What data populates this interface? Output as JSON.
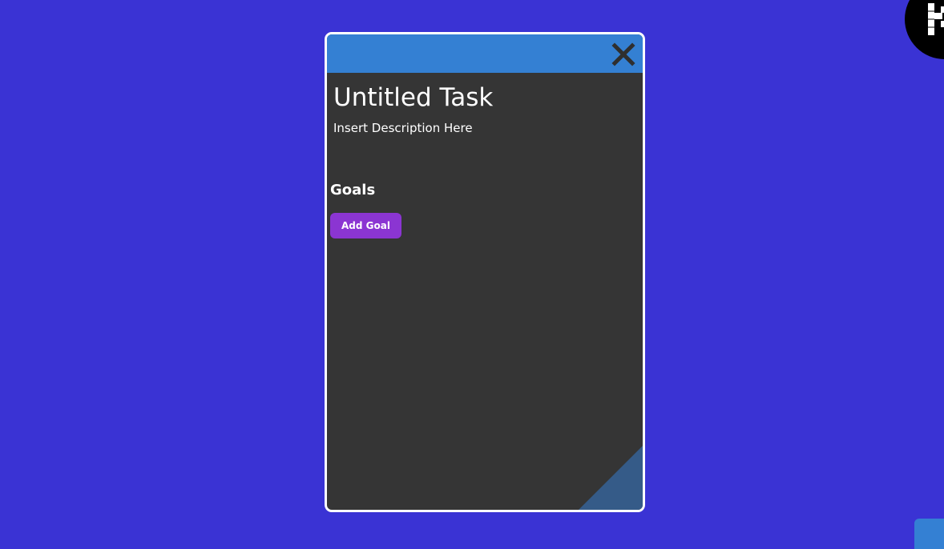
{
  "task": {
    "title": "Untitled Task",
    "description": "Insert Description Here"
  },
  "goals": {
    "heading": "Goals",
    "add_button_label": "Add Goal"
  },
  "icons": {
    "close": "close-icon",
    "resize": "resize-corner-icon",
    "logo": "app-logo-icon"
  },
  "colors": {
    "background": "#3a33d4",
    "modal_header": "#3480d3",
    "modal_body": "#353535",
    "add_goal_button": "#8b35d2",
    "resize_corner": "#355b88"
  }
}
